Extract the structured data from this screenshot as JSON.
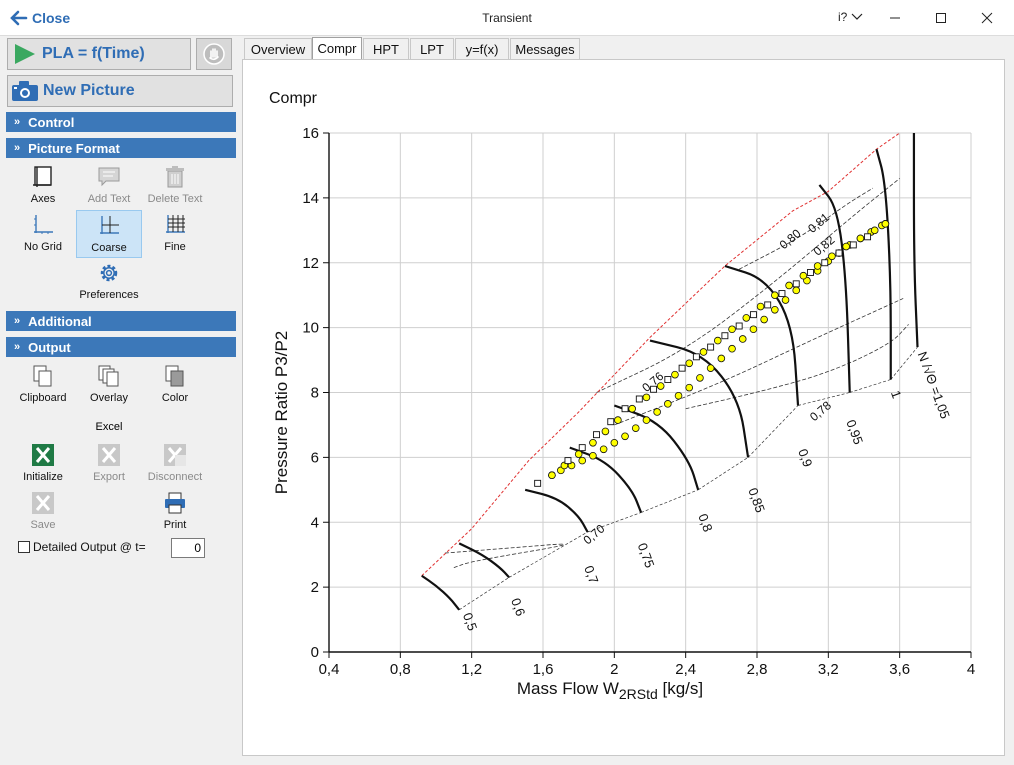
{
  "window": {
    "title": "Transient",
    "close_label": "Close",
    "help_label": "i?"
  },
  "left_panel": {
    "pla_button": "PLA = f(Time)",
    "new_picture_button": "New Picture",
    "sections": {
      "control": "Control",
      "picture_format": "Picture Format",
      "additional": "Additional",
      "output": "Output"
    },
    "picture_format_tools": {
      "axes": "Axes",
      "add_text": "Add Text",
      "delete_text": "Delete Text",
      "no_grid": "No Grid",
      "coarse": "Coarse",
      "fine": "Fine",
      "preferences": "Preferences"
    },
    "output_tools": {
      "clipboard": "Clipboard",
      "overlay": "Overlay",
      "color": "Color",
      "excel_label": "Excel",
      "initialize": "Initialize",
      "export": "Export",
      "disconnect": "Disconnect",
      "save": "Save",
      "print": "Print"
    },
    "detailed_output_label": "Detailed Output @ t=",
    "detailed_output_value": "0"
  },
  "tabs": [
    {
      "label": "Overview",
      "active": false
    },
    {
      "label": "Compr",
      "active": true
    },
    {
      "label": "HPT",
      "active": false
    },
    {
      "label": "LPT",
      "active": false
    },
    {
      "label": "y=f(x)",
      "active": false
    },
    {
      "label": "Messages",
      "active": false
    }
  ],
  "colors": {
    "accent": "#3c78b9",
    "surge_line": "#e03030",
    "marker_fill": "#ffff00"
  },
  "chart_data": {
    "type": "scatter",
    "title": "Compr",
    "xlabel": "Mass Flow W",
    "xlabel_sub": "2RStd",
    "xlabel_unit": " [kg/s]",
    "ylabel": "Pressure Ratio  P3/P2",
    "xlim": [
      0.4,
      4
    ],
    "ylim": [
      0,
      16
    ],
    "x_ticks": [
      "0,4",
      "0,8",
      "1,2",
      "1,6",
      "2",
      "2,4",
      "2,8",
      "3,2",
      "3,6",
      "4"
    ],
    "y_ticks": [
      "0",
      "2",
      "4",
      "6",
      "8",
      "10",
      "12",
      "14",
      "16"
    ],
    "grid": true,
    "surge_line": [
      [
        0.92,
        2.35
      ],
      [
        1.2,
        3.8
      ],
      [
        1.52,
        5.9
      ],
      [
        1.8,
        7.4
      ],
      [
        2.2,
        9.7
      ],
      [
        2.62,
        11.9
      ],
      [
        3.0,
        13.6
      ],
      [
        3.2,
        14.2
      ],
      [
        3.47,
        15.5
      ],
      [
        3.6,
        16.0
      ]
    ],
    "speed_lines": [
      {
        "label": "0,5",
        "points": [
          [
            0.92,
            2.35
          ],
          [
            1.0,
            2.05
          ],
          [
            1.08,
            1.65
          ],
          [
            1.13,
            1.3
          ]
        ],
        "label_at": [
          1.15,
          1.15
        ]
      },
      {
        "label": "0,6",
        "points": [
          [
            1.13,
            3.35
          ],
          [
            1.26,
            3.0
          ],
          [
            1.36,
            2.6
          ],
          [
            1.41,
            2.3
          ]
        ],
        "label_at": [
          1.42,
          1.6
        ]
      },
      {
        "label": "0,7",
        "points": [
          [
            1.5,
            5.0
          ],
          [
            1.68,
            4.75
          ],
          [
            1.8,
            4.2
          ],
          [
            1.85,
            3.7
          ]
        ],
        "label_at": [
          1.83,
          2.6
        ]
      },
      {
        "label": "0,75",
        "points": [
          [
            1.75,
            6.3
          ],
          [
            1.95,
            5.9
          ],
          [
            2.1,
            5.0
          ],
          [
            2.15,
            4.3
          ]
        ],
        "label_at": [
          2.13,
          3.3
        ]
      },
      {
        "label": "0,8",
        "points": [
          [
            2.0,
            7.6
          ],
          [
            2.25,
            7.1
          ],
          [
            2.42,
            5.9
          ],
          [
            2.47,
            5.0
          ]
        ],
        "label_at": [
          2.47,
          4.2
        ]
      },
      {
        "label": "0,85",
        "points": [
          [
            2.2,
            9.6
          ],
          [
            2.5,
            9.2
          ],
          [
            2.7,
            7.8
          ],
          [
            2.75,
            6.0
          ]
        ],
        "label_at": [
          2.75,
          5.0
        ]
      },
      {
        "label": "0,9",
        "points": [
          [
            2.62,
            11.9
          ],
          [
            2.85,
            11.5
          ],
          [
            3.0,
            10.1
          ],
          [
            3.03,
            7.6
          ]
        ],
        "label_at": [
          3.03,
          6.2
        ]
      },
      {
        "label": "0,95",
        "points": [
          [
            3.15,
            14.4
          ],
          [
            3.25,
            13.7
          ],
          [
            3.3,
            11.5
          ],
          [
            3.32,
            8.0
          ]
        ],
        "label_at": [
          3.3,
          7.1
        ]
      },
      {
        "label": "1",
        "points": [
          [
            3.47,
            15.5
          ],
          [
            3.52,
            14.5
          ],
          [
            3.55,
            11.5
          ],
          [
            3.55,
            8.4
          ]
        ],
        "label_at": [
          3.55,
          8.0
        ]
      },
      {
        "label": "N /√Θ =1,05",
        "points": [
          [
            3.68,
            16.0
          ],
          [
            3.68,
            12.0
          ],
          [
            3.7,
            9.4
          ]
        ],
        "label_at": [
          3.7,
          9.2
        ]
      }
    ],
    "efficiency_labels": [
      {
        "label": "0,70",
        "at": [
          1.85,
          3.3
        ]
      },
      {
        "label": "0,76",
        "at": [
          2.18,
          8.0
        ]
      },
      {
        "label": "0,78",
        "at": [
          3.12,
          7.1
        ]
      },
      {
        "label": "0,80",
        "at": [
          2.95,
          12.4
        ]
      },
      {
        "label": "0,81",
        "at": [
          3.11,
          12.9
        ]
      },
      {
        "label": "0,82",
        "at": [
          3.14,
          12.2
        ]
      }
    ],
    "efficiency_contours": [
      [
        [
          1.05,
          3.05
        ],
        [
          1.4,
          3.2
        ],
        [
          1.85,
          3.4
        ],
        [
          1.2,
          2.8
        ],
        [
          1.1,
          2.6
        ]
      ],
      [
        [
          1.9,
          8.0
        ],
        [
          2.4,
          9.3
        ],
        [
          2.9,
          11.4
        ],
        [
          3.35,
          13.5
        ],
        [
          3.6,
          14.6
        ]
      ],
      [
        [
          2.0,
          7.0
        ],
        [
          2.6,
          8.3
        ],
        [
          3.1,
          9.6
        ],
        [
          3.5,
          10.6
        ],
        [
          3.62,
          10.9
        ]
      ],
      [
        [
          2.4,
          7.5
        ],
        [
          2.8,
          8.0
        ],
        [
          3.2,
          8.6
        ],
        [
          3.55,
          9.5
        ],
        [
          3.65,
          10.1
        ]
      ],
      [
        [
          2.7,
          11.8
        ],
        [
          3.05,
          12.8
        ],
        [
          3.3,
          13.8
        ],
        [
          3.45,
          14.3
        ]
      ]
    ],
    "series": [
      {
        "marker": "circle",
        "points": [
          [
            1.65,
            5.45
          ],
          [
            1.7,
            5.6
          ],
          [
            1.76,
            5.75
          ],
          [
            1.82,
            5.9
          ],
          [
            1.88,
            6.05
          ],
          [
            1.94,
            6.25
          ],
          [
            2.0,
            6.45
          ],
          [
            2.06,
            6.65
          ],
          [
            2.12,
            6.9
          ],
          [
            2.18,
            7.15
          ],
          [
            2.24,
            7.4
          ],
          [
            2.3,
            7.65
          ],
          [
            2.36,
            7.9
          ],
          [
            2.42,
            8.15
          ],
          [
            2.48,
            8.45
          ],
          [
            2.54,
            8.75
          ],
          [
            2.6,
            9.05
          ],
          [
            2.66,
            9.35
          ],
          [
            2.72,
            9.65
          ],
          [
            2.78,
            9.95
          ],
          [
            2.84,
            10.25
          ],
          [
            2.9,
            10.55
          ],
          [
            2.96,
            10.85
          ],
          [
            3.02,
            11.15
          ],
          [
            3.08,
            11.45
          ],
          [
            3.14,
            11.75
          ],
          [
            3.2,
            12.05
          ],
          [
            3.26,
            12.3
          ],
          [
            3.32,
            12.55
          ],
          [
            3.38,
            12.75
          ],
          [
            3.44,
            12.95
          ],
          [
            3.5,
            13.15
          ],
          [
            3.52,
            13.2
          ]
        ]
      },
      {
        "marker": "circle",
        "points": [
          [
            1.65,
            5.45
          ],
          [
            1.72,
            5.75
          ],
          [
            1.8,
            6.1
          ],
          [
            1.88,
            6.45
          ],
          [
            1.95,
            6.8
          ],
          [
            2.02,
            7.15
          ],
          [
            2.1,
            7.5
          ],
          [
            2.18,
            7.85
          ],
          [
            2.26,
            8.2
          ],
          [
            2.34,
            8.55
          ],
          [
            2.42,
            8.9
          ],
          [
            2.5,
            9.25
          ],
          [
            2.58,
            9.6
          ],
          [
            2.66,
            9.95
          ],
          [
            2.74,
            10.3
          ],
          [
            2.82,
            10.65
          ],
          [
            2.9,
            11.0
          ],
          [
            2.98,
            11.3
          ],
          [
            3.06,
            11.6
          ],
          [
            3.14,
            11.9
          ],
          [
            3.22,
            12.2
          ],
          [
            3.3,
            12.5
          ],
          [
            3.38,
            12.75
          ],
          [
            3.46,
            13.0
          ],
          [
            3.52,
            13.2
          ]
        ]
      },
      {
        "marker": "square",
        "points": [
          [
            1.57,
            5.2
          ],
          [
            1.74,
            5.9
          ],
          [
            1.82,
            6.3
          ],
          [
            1.9,
            6.7
          ],
          [
            1.98,
            7.1
          ],
          [
            2.06,
            7.5
          ],
          [
            2.14,
            7.8
          ],
          [
            2.22,
            8.1
          ],
          [
            2.3,
            8.4
          ],
          [
            2.38,
            8.75
          ],
          [
            2.46,
            9.1
          ],
          [
            2.54,
            9.4
          ],
          [
            2.62,
            9.75
          ],
          [
            2.7,
            10.05
          ],
          [
            2.78,
            10.4
          ],
          [
            2.86,
            10.7
          ],
          [
            2.94,
            11.05
          ],
          [
            3.02,
            11.35
          ],
          [
            3.1,
            11.7
          ],
          [
            3.18,
            12.0
          ],
          [
            3.26,
            12.3
          ],
          [
            3.34,
            12.55
          ],
          [
            3.42,
            12.8
          ]
        ]
      }
    ]
  }
}
